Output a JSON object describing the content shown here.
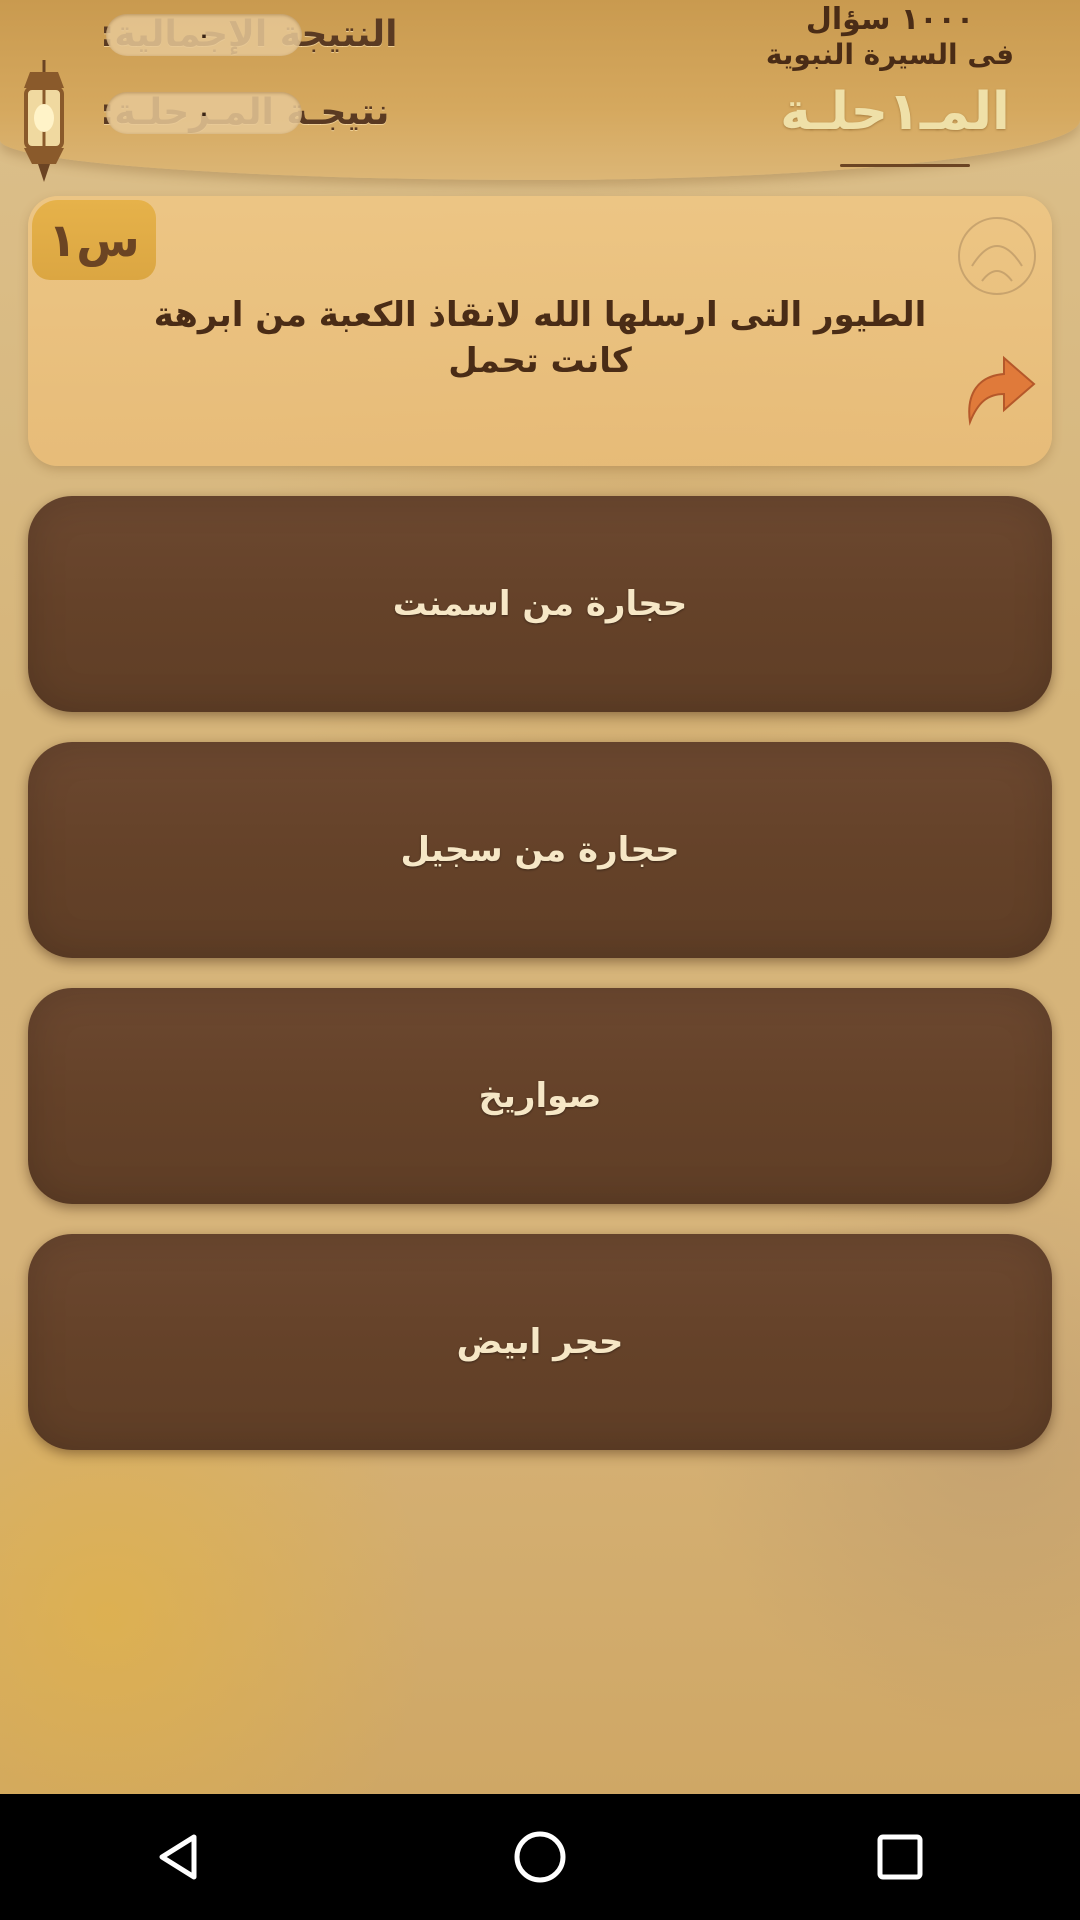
{
  "header": {
    "total_score_label": "النتيجة الإجمالية:",
    "total_score_value": "٠",
    "stage_score_label": "نتيجـة المـرحلـة:",
    "stage_score_value": "٠",
    "app_title_line1": "١٠٠٠ سؤال",
    "app_title_line2": "فى السيرة النبوية",
    "stage_title": "المـ١حلـة"
  },
  "question": {
    "badge": "س١",
    "text": "الطيور التى ارسلها الله لانقاذ الكعبة من ابرهة كانت تحمل"
  },
  "answers": [
    {
      "label": "حجارة من اسمنت"
    },
    {
      "label": "حجارة من سجيل"
    },
    {
      "label": "صواريخ"
    },
    {
      "label": "حجر ابيض"
    }
  ],
  "nav": {
    "back_icon": "triangle-left",
    "home_icon": "circle",
    "recents_icon": "square"
  },
  "colors": {
    "answer_bg": "#654229",
    "answer_text": "#f6e7c6",
    "card_bg": "#e8bc78",
    "arrow": "#e07a3a"
  }
}
